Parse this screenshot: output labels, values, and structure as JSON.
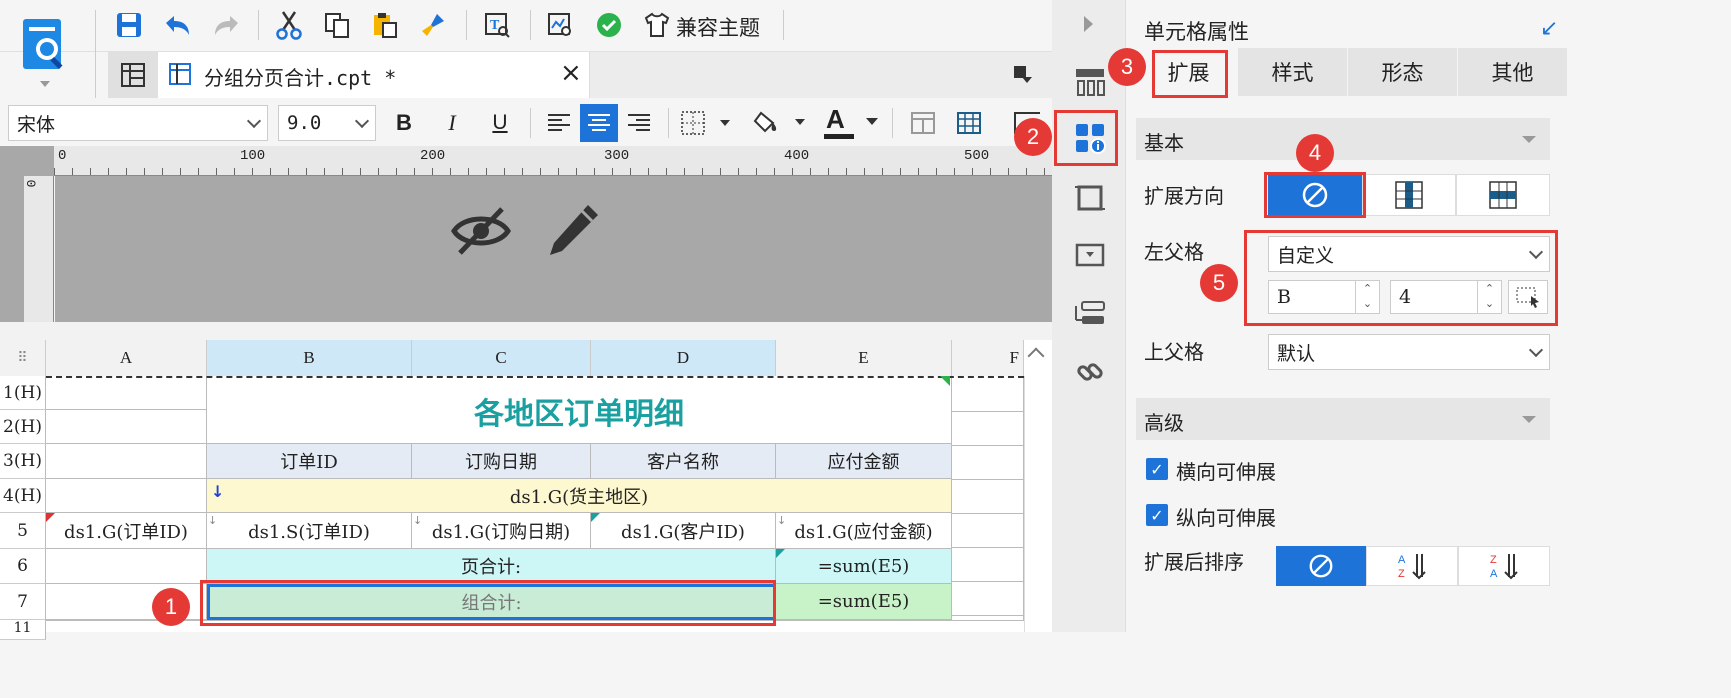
{
  "toolbar": {
    "compat_theme": "兼容主题"
  },
  "file_tab": {
    "title": "分组分页合计.cpt *",
    "close": "×"
  },
  "format_bar": {
    "font": "宋体",
    "size": "9.0",
    "bold": "B",
    "italic": "I",
    "underline": "U",
    "font_color_glyph": "A"
  },
  "ruler": {
    "marks": [
      "0",
      "100",
      "200",
      "300",
      "400",
      "500"
    ],
    "vmark": "0"
  },
  "grid": {
    "columns": [
      "A",
      "B",
      "C",
      "D",
      "E",
      "F"
    ],
    "rows": [
      "1(H)",
      "2(H)",
      "3(H)",
      "4(H)",
      "5",
      "6",
      "7",
      "11"
    ],
    "title": "各地区订单明细",
    "headers": [
      "订单ID",
      "订购日期",
      "客户名称",
      "应付金额"
    ],
    "region": "ds1.G(货主地区)",
    "r5": [
      "ds1.G(订单ID)",
      "ds1.S(订单ID)",
      "ds1.G(订购日期)",
      "ds1.G(客户ID)",
      "ds1.G(应付金额)"
    ],
    "page_total_label": "页合计:",
    "group_total_label": "组合计:",
    "sum_formula": "=sum(E5)"
  },
  "panel": {
    "title": "单元格属性",
    "tabs": [
      "扩展",
      "样式",
      "形态",
      "其他"
    ],
    "section_basic": "基本",
    "expand_direction": "扩展方向",
    "left_parent": "左父格",
    "left_parent_value": "自定义",
    "left_parent_col": "B",
    "left_parent_row": "4",
    "up_parent": "上父格",
    "up_parent_value": "默认",
    "section_advanced": "高级",
    "h_expand": "横向可伸展",
    "v_expand": "纵向可伸展",
    "sort_after": "扩展后排序"
  },
  "badges": [
    "1",
    "2",
    "3",
    "4",
    "5"
  ],
  "colors": {
    "accent": "#1e73d9",
    "highlight_red": "#e53935",
    "title_teal": "#1aa0a0",
    "header_bg": "#e4ebf5",
    "region_bg": "#fdf8cf",
    "total_bg": "#cdf7f7",
    "selected_bg": "#c8ecd6"
  }
}
